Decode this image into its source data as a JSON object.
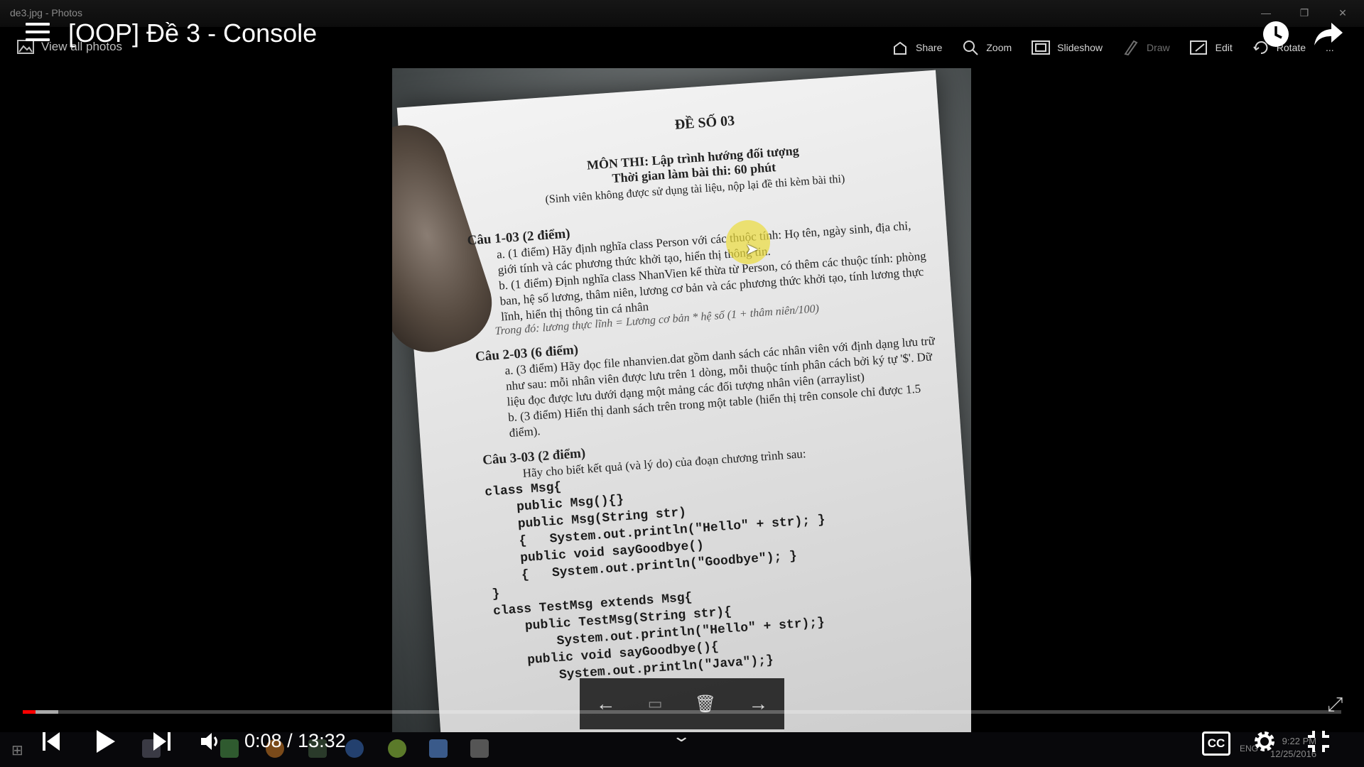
{
  "photos_app": {
    "title": "de3.jpg - Photos",
    "view_all_label": "View all photos",
    "toolbar": [
      {
        "label": "Share",
        "icon": "share-icon",
        "enabled": true
      },
      {
        "label": "Zoom",
        "icon": "zoom-icon",
        "enabled": true
      },
      {
        "label": "Slideshow",
        "icon": "slideshow-icon",
        "enabled": true
      },
      {
        "label": "Draw",
        "icon": "draw-icon",
        "enabled": false
      },
      {
        "label": "Edit",
        "icon": "edit-icon",
        "enabled": true
      },
      {
        "label": "Rotate",
        "icon": "rotate-icon",
        "enabled": true
      }
    ],
    "more_label": "...",
    "nav": {
      "prev_icon": "arrow-left-icon",
      "delete_icon": "trash-icon",
      "next_icon": "arrow-right-icon"
    }
  },
  "document": {
    "heading": "ĐỀ SỐ 03",
    "subject": "MÔN THI: Lập trình hướng đối tượng",
    "duration": "Thời gian làm bài thi: 60 phút",
    "note": "(Sinh viên không được sử dụng tài liệu, nộp lại đề thi kèm bài thi)",
    "q1_title": "Câu 1-03 (2 điểm)",
    "q1_a": "a. (1 điểm) Hãy định nghĩa class Person với các thuộc tính: Họ tên, ngày sinh, địa chỉ, giới tính và các phương thức khởi tạo, hiển thị thông tin.",
    "q1_b": "b. (1 điểm) Định nghĩa class NhanVien kế thừa từ Person, có thêm các thuộc tính: phòng ban, hệ số lương, thâm niên, lương cơ bản và các phương thức khởi tạo, tính lương thực lĩnh, hiển thị thông tin cá nhân",
    "q1_formula": "Trong đó: lương thực lĩnh = Lương cơ bản * hệ số (1 + thâm niên/100)",
    "q2_title": "Câu 2-03 (6 điểm)",
    "q2_a": "a. (3 điểm) Hãy đọc file nhanvien.dat gồm danh sách các nhân viên với định dạng lưu trữ như sau: mỗi nhân viên được lưu trên 1 dòng, mỗi thuộc tính phân cách bởi ký tự '$'. Dữ liệu đọc được lưu dưới dạng một mảng các đối tượng nhân viên (arraylist)",
    "q2_b": "b. (3 điểm) Hiển thị danh sách trên trong một table (hiển thị trên console chỉ được 1.5 điểm).",
    "q3_title": "Câu 3-03 (2 điểm)",
    "q3_text": "Hãy cho biết kết quả (và lý do) của đoạn chương trình sau:",
    "code": "class Msg{\n    public Msg(){}\n    public Msg(String str)\n    {   System.out.println(\"Hello\" + str); }\n    public void sayGoodbye()\n    {   System.out.println(\"Goodbye\"); }\n}\nclass TestMsg extends Msg{\n    public TestMsg(String str){\n        System.out.println(\"Hello\" + str);}\n    public void sayGoodbye(){\n        System.out.println(\"Java\");}"
  },
  "youtube": {
    "video_title": "[OOP] Đề 3 - Console",
    "time_current": "0:08",
    "time_separator": "/",
    "time_total": "13:32",
    "progress_played_fraction": 0.0099,
    "progress_buffered_fraction": 0.027,
    "cc_label": "CC"
  },
  "taskbar": {
    "language": "ENG",
    "time": "9:22 PM",
    "date": "12/25/2016"
  },
  "colors": {
    "progress": "#ff0000",
    "cursor_halo": "#ebdc3c"
  }
}
